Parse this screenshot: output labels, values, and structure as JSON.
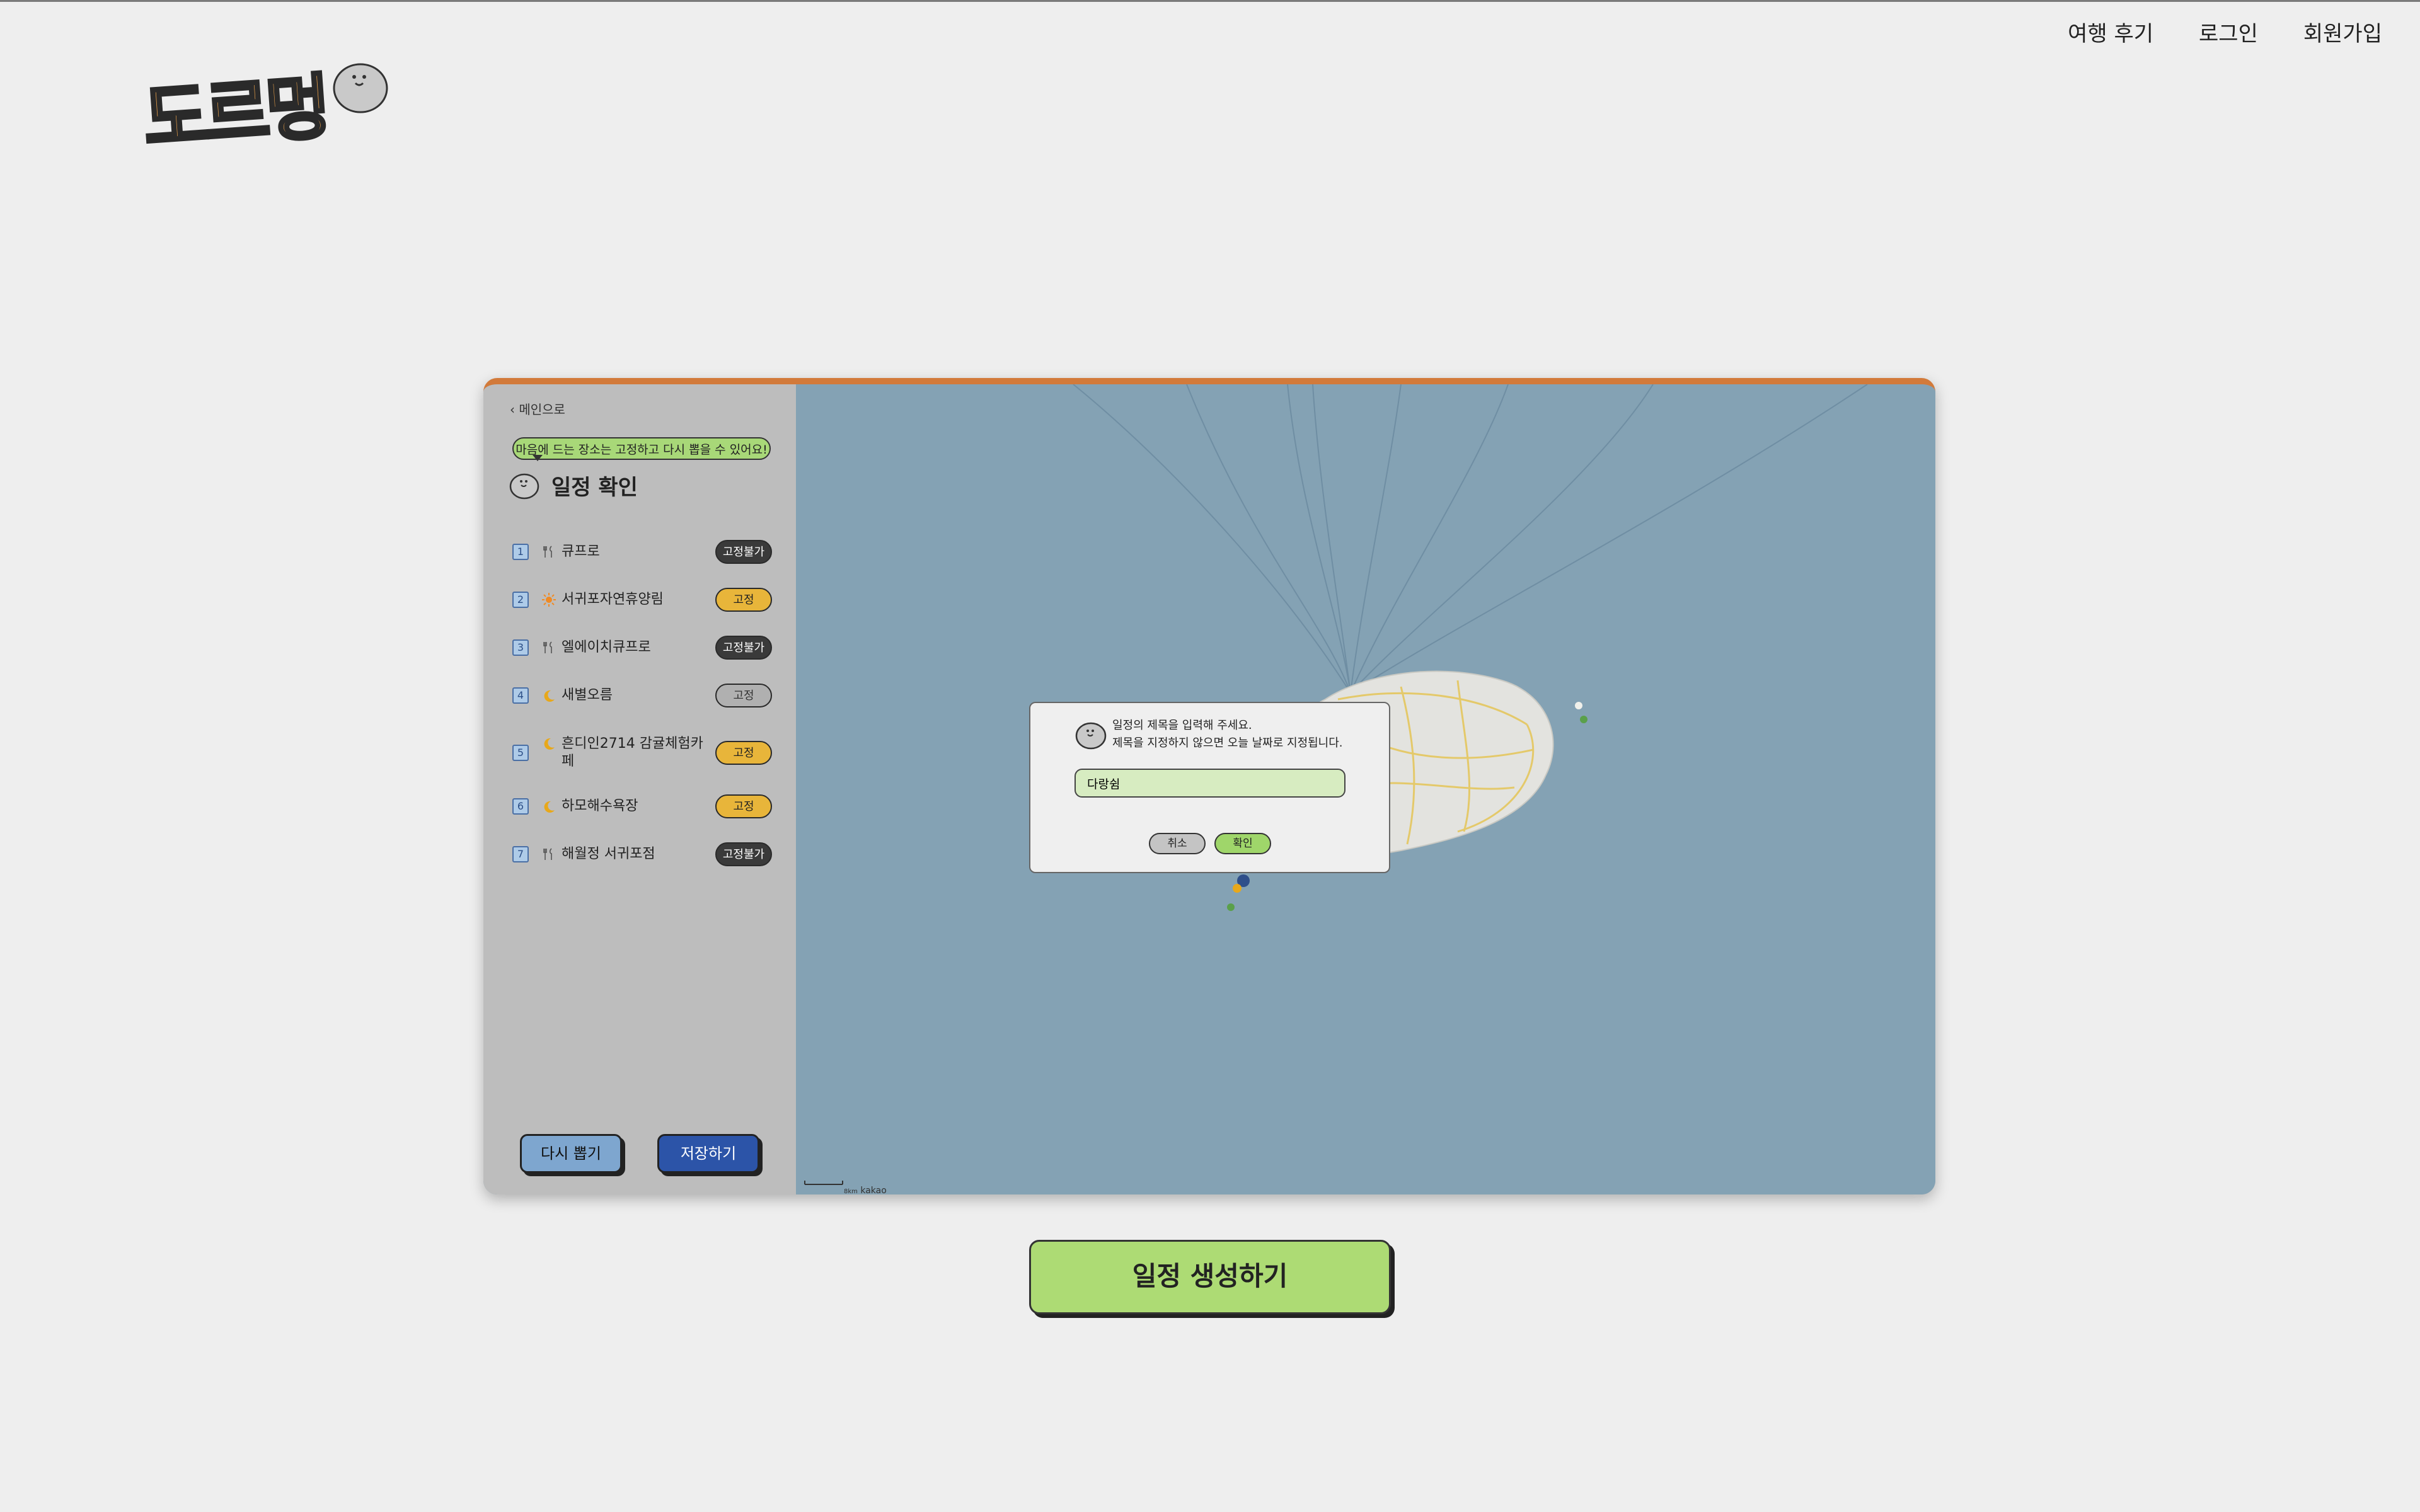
{
  "header": {
    "logo_text": "도르멍",
    "nav": [
      "여행 후기",
      "로그인",
      "회원가입"
    ]
  },
  "sidebar": {
    "back_label": "메인으로",
    "tip": "마음에 드는 장소는 고정하고 다시 뽑을 수 있어요!",
    "title": "일정 확인",
    "items": [
      {
        "num": "1",
        "icon": "fork-knife-icon",
        "name": "큐프로",
        "badge": "고정불가"
      },
      {
        "num": "2",
        "icon": "sun-icon",
        "name": "서귀포자연휴양림",
        "badge": "고정"
      },
      {
        "num": "3",
        "icon": "fork-knife-icon",
        "name": "엘에이치큐프로",
        "badge": "고정불가"
      },
      {
        "num": "4",
        "icon": "moon-icon",
        "name": "새별오름",
        "badge": "고정"
      },
      {
        "num": "5",
        "icon": "moon-icon",
        "name": "흔디인2714 감귤체험카페",
        "badge": "고정"
      },
      {
        "num": "6",
        "icon": "moon-icon",
        "name": "하모해수욕장",
        "badge": "고정"
      },
      {
        "num": "7",
        "icon": "fork-knife-icon",
        "name": "해월정 서귀포점",
        "badge": "고정불가"
      }
    ],
    "retry_label": "다시 뽑기",
    "save_label": "저장하기"
  },
  "map": {
    "attribution": "kakao",
    "scale": "8km"
  },
  "dialog": {
    "line1": "일정의 제목을 입력해 주세요.",
    "line2": "제목을 지정하지 않으면 오늘 날짜로 지정됩니다.",
    "input_value": "다랑쉼",
    "cancel_label": "취소",
    "ok_label": "확인"
  },
  "create_label": "일정 생성하기",
  "colors": {
    "accent_orange": "#d27a3a",
    "green": "#addb74",
    "blue_dark": "#2c54a8",
    "badge_yellow": "#e8b53a"
  }
}
